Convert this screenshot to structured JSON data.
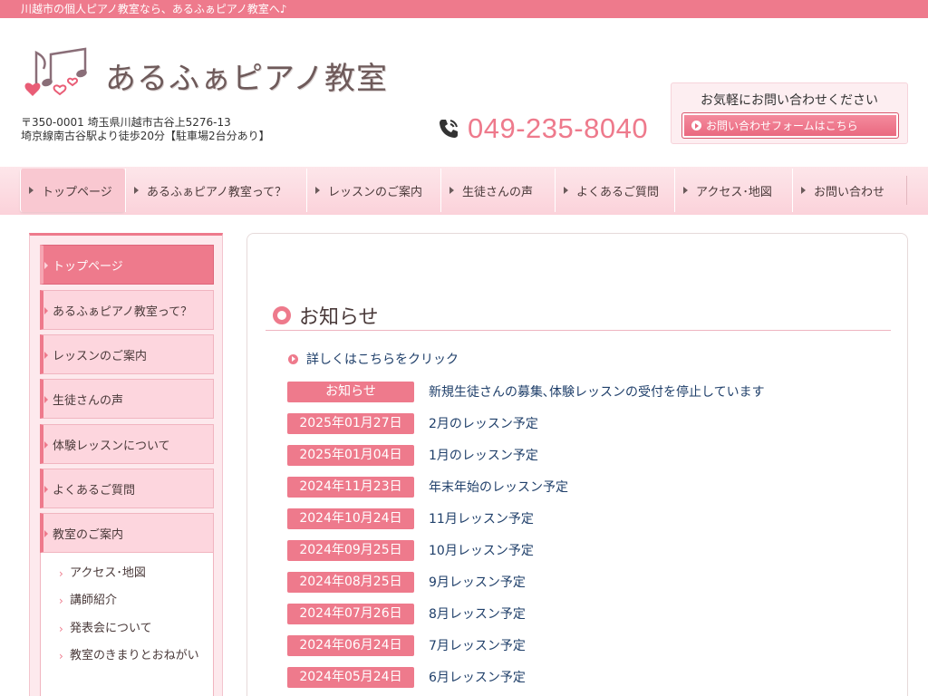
{
  "topbar": {
    "text": "川越市の個人ピアノ教室なら、あるふぁピアノ教室へ♪"
  },
  "header": {
    "logo_text": "あるふぁピアノ教室",
    "address_line1": "〒350-0001 埼玉県川越市古谷上5276-13",
    "address_line2": "埼京線南古谷駅より徒歩20分【駐車場2台分あり】",
    "phone": "049-235-8040",
    "contact_caption": "お気軽にお問い合わせください",
    "contact_button": "お問い合わせフォームはこちら"
  },
  "gnav": [
    {
      "label": "トップページ"
    },
    {
      "label": "あるふぁピアノ教室って？"
    },
    {
      "label": "レッスンのご案内"
    },
    {
      "label": "生徒さんの声"
    },
    {
      "label": "よくあるご質問"
    },
    {
      "label": "アクセス･地図"
    },
    {
      "label": "お問い合わせ"
    }
  ],
  "sidebar": {
    "items": [
      {
        "label": "トップページ"
      },
      {
        "label": "あるふぁピアノ教室って？"
      },
      {
        "label": "レッスンのご案内"
      },
      {
        "label": "生徒さんの声"
      },
      {
        "label": "体験レッスンについて"
      },
      {
        "label": "よくあるご質問"
      },
      {
        "label": "教室のご案内"
      }
    ],
    "sub_items": [
      {
        "label": "アクセス･地図"
      },
      {
        "label": "講師紹介"
      },
      {
        "label": "発表会について"
      },
      {
        "label": "教室のきまりとおねがい"
      }
    ]
  },
  "main": {
    "section_title": "お知らせ",
    "more_link": "詳しくはこちらをクリック",
    "news": [
      {
        "date": "お知らせ",
        "title": "新規生徒さんの募集､体験レッスンの受付を停止しています"
      },
      {
        "date": "2025年01月27日",
        "title": "2月のレッスン予定"
      },
      {
        "date": "2025年01月04日",
        "title": "1月のレッスン予定"
      },
      {
        "date": "2024年11月23日",
        "title": "年末年始のレッスン予定"
      },
      {
        "date": "2024年10月24日",
        "title": "11月レッスン予定"
      },
      {
        "date": "2024年09月25日",
        "title": "10月レッスン予定"
      },
      {
        "date": "2024年08月25日",
        "title": "9月レッスン予定"
      },
      {
        "date": "2024年07月26日",
        "title": "8月レッスン予定"
      },
      {
        "date": "2024年06月24日",
        "title": "7月レッスン予定"
      },
      {
        "date": "2024年05月24日",
        "title": "6月レッスン予定"
      }
    ]
  },
  "colors": {
    "accent": "#ee7a8c",
    "nav_bg": "#fbd2da",
    "link": "#1f3f6a"
  },
  "icons": {
    "logo": "music-notes-hearts-icon",
    "phone": "phone-icon",
    "arrow": "circle-arrow-icon"
  }
}
